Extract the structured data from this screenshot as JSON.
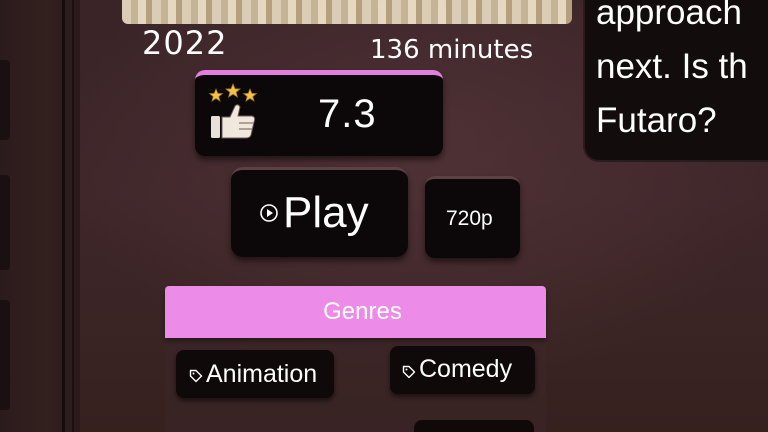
{
  "movie": {
    "year": "2022",
    "runtime": "136 minutes",
    "description_lines": [
      "approach",
      "next. Is th",
      "Futaro?"
    ]
  },
  "rating": {
    "value": "7.3",
    "icon": "thumbs-up-stars-icon",
    "accent_color": "#e27ee0"
  },
  "actions": {
    "play_label": "Play",
    "play_icon": "play-circle-icon",
    "quality_label": "720p"
  },
  "genres": {
    "header": "Genres",
    "header_color": "#ec8ce8",
    "tag_icon": "tag-icon",
    "items": [
      "Animation",
      "Comedy"
    ]
  }
}
